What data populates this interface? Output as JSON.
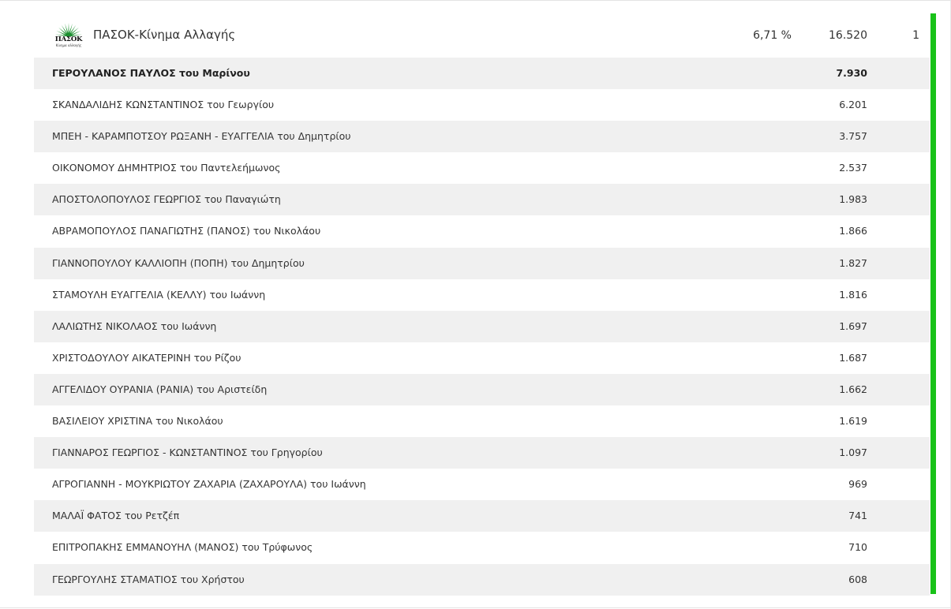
{
  "party": {
    "logo_text": "ΠΑΣΟΚ",
    "logo_subtext": "Κίνημα αλλαγής",
    "name": "ΠΑΣΟΚ-Κίνημα Αλλαγής",
    "percentage": "6,71 %",
    "votes": "16.520",
    "seats": "1",
    "accent_color": "#19c219",
    "logo_color": "#1a8f2e"
  },
  "candidates": [
    {
      "name": "ΓΕΡΟΥΛΑΝΟΣ ΠΑΥΛΟΣ του Μαρίνου",
      "votes": "7.930",
      "elected": true
    },
    {
      "name": "ΣΚΑΝΔΑΛΙΔΗΣ ΚΩΝΣΤΑΝΤΙΝΟΣ του Γεωργίου",
      "votes": "6.201"
    },
    {
      "name": "ΜΠΕΗ - ΚΑΡΑΜΠΟΤΣΟΥ ΡΩΞΑΝΗ - ΕΥΑΓΓΕΛΙΑ του Δημητρίου",
      "votes": "3.757"
    },
    {
      "name": "ΟΙΚΟΝΟΜΟΥ ΔΗΜΗΤΡΙΟΣ του Παντελεήμωνος",
      "votes": "2.537"
    },
    {
      "name": "ΑΠΟΣΤΟΛΟΠΟΥΛΟΣ ΓΕΩΡΓΙΟΣ του Παναγιώτη",
      "votes": "1.983"
    },
    {
      "name": "ΑΒΡΑΜΟΠΟΥΛΟΣ ΠΑΝΑΓΙΩΤΗΣ (ΠΑΝΟΣ) του Νικολάου",
      "votes": "1.866"
    },
    {
      "name": "ΓΙΑΝΝΟΠΟΥΛΟΥ ΚΑΛΛΙΟΠΗ (ΠΟΠΗ) του Δημητρίου",
      "votes": "1.827"
    },
    {
      "name": "ΣΤΑΜΟΥΛΗ ΕΥΑΓΓΕΛΙΑ (ΚΕΛΛΥ) του Ιωάννη",
      "votes": "1.816"
    },
    {
      "name": "ΛΑΛΙΩΤΗΣ ΝΙΚΟΛΑΟΣ του Ιωάννη",
      "votes": "1.697"
    },
    {
      "name": "ΧΡΙΣΤΟΔΟΥΛΟΥ ΑΙΚΑΤΕΡΙΝΗ του Ρίζου",
      "votes": "1.687"
    },
    {
      "name": "ΑΓΓΕΛΙΔΟΥ ΟΥΡΑΝΙΑ (ΡΑΝΙΑ) του Αριστείδη",
      "votes": "1.662"
    },
    {
      "name": "ΒΑΣΙΛΕΙΟΥ ΧΡΙΣΤΙΝΑ του Νικολάου",
      "votes": "1.619"
    },
    {
      "name": "ΓΙΑΝΝΑΡΟΣ ΓΕΩΡΓΙΟΣ - ΚΩΝΣΤΑΝΤΙΝΟΣ του Γρηγορίου",
      "votes": "1.097"
    },
    {
      "name": "ΑΓΡΟΓΙΑΝΝΗ - ΜΟΥΚΡΙΩΤΟΥ ΖΑΧΑΡΙΑ (ΖΑΧΑΡΟΥΛΑ) του Ιωάννη",
      "votes": "969"
    },
    {
      "name": "ΜΑΛΑΪ ΦΑΤΟΣ του Ρετζέπ",
      "votes": "741"
    },
    {
      "name": "ΕΠΙΤΡΟΠΑΚΗΣ ΕΜΜΑΝΟΥΗΛ (ΜΑΝΟΣ) του Τρύφωνος",
      "votes": "710"
    },
    {
      "name": "ΓΕΩΡΓΟΥΛΗΣ ΣΤΑΜΑΤΙΟΣ του Χρήστου",
      "votes": "608"
    }
  ]
}
